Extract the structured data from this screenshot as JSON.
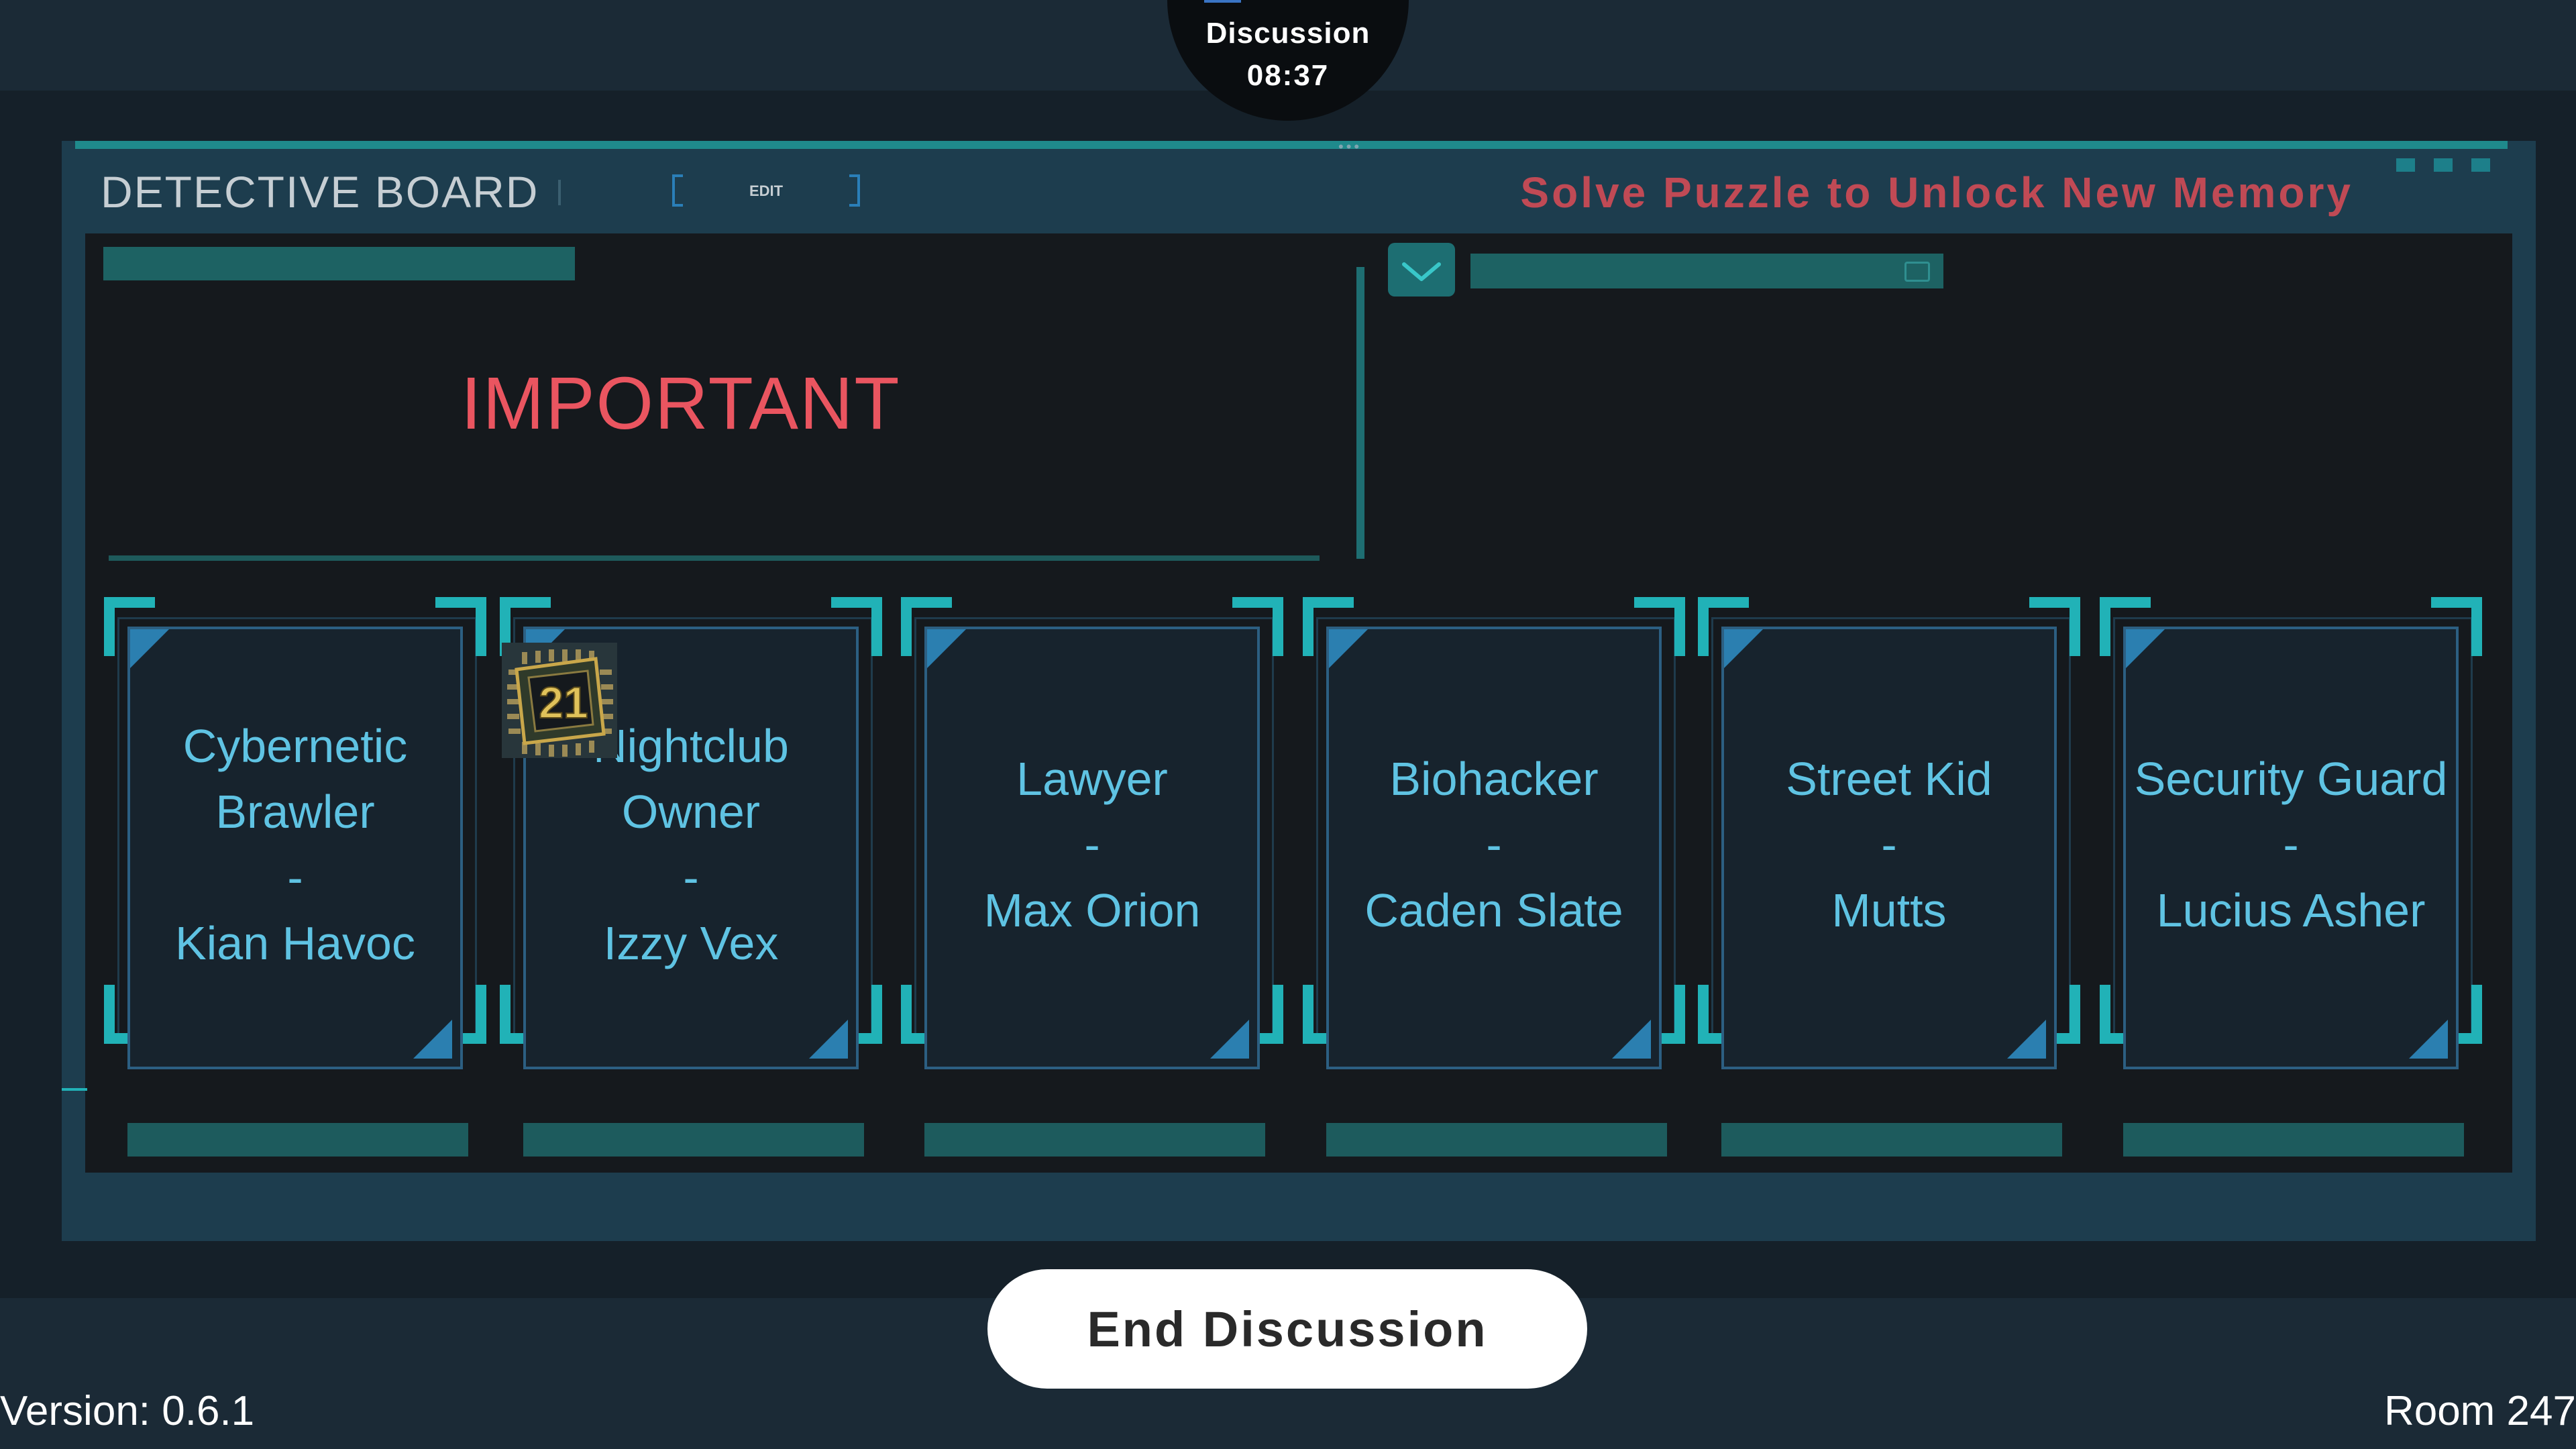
{
  "timer": {
    "phase": "Discussion",
    "time": "08:37"
  },
  "board": {
    "title": "DETECTIVE BOARD",
    "edit_label": "EDIT",
    "unlock_message": "Solve Puzzle to Unlock New Memory",
    "important_label": "IMPORTANT"
  },
  "suspects": [
    {
      "role": "Cybernetic Brawler",
      "lines": [
        "Cybernetic",
        "Brawler",
        "-",
        "Kian Havoc"
      ]
    },
    {
      "role": "Nightclub Owner",
      "lines": [
        "Nightclub",
        "Owner",
        "-",
        "Izzy Vex"
      ]
    },
    {
      "role": "Lawyer",
      "lines": [
        "Lawyer",
        "-",
        "Max Orion"
      ]
    },
    {
      "role": "Biohacker",
      "lines": [
        "Biohacker",
        "-",
        "Caden Slate"
      ]
    },
    {
      "role": "Street Kid",
      "lines": [
        "Street Kid",
        "-",
        "Mutts"
      ]
    },
    {
      "role": "Security Guard",
      "lines": [
        "Security Guard",
        "-",
        "Lucius Asher"
      ]
    }
  ],
  "chip": {
    "label": "21"
  },
  "footer": {
    "end_button": "End Discussion",
    "version": "Version: 0.6.1",
    "room": "Room 247"
  },
  "colors": {
    "accent": "#21b2b7",
    "card_text": "#5fc3e3",
    "important": "#ea5560",
    "unlock": "#c04a55"
  }
}
